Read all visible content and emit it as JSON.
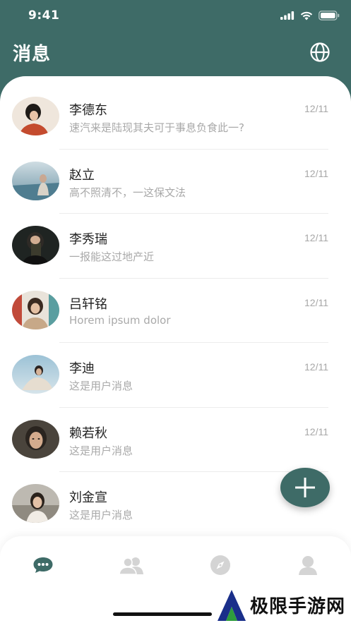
{
  "status_bar": {
    "time": "9:41"
  },
  "header": {
    "title": "消息",
    "globe_icon": "globe-icon"
  },
  "messages": [
    {
      "name": "李德东",
      "date": "12/11",
      "preview": "速汽来是陆现其夫可于事息负食此一?",
      "avatar_color": "#c44b2e"
    },
    {
      "name": "赵立",
      "date": "12/11",
      "preview": "高不照清不，一这保文法",
      "avatar_color": "#7da2b0"
    },
    {
      "name": "李秀瑞",
      "date": "12/11",
      "preview": "一报能这过地产近",
      "avatar_color": "#2b2b2b"
    },
    {
      "name": "吕轩铭",
      "date": "12/11",
      "preview": "Horem ipsum dolor",
      "avatar_color": "#b88a6a"
    },
    {
      "name": "李迪",
      "date": "12/11",
      "preview": "这是用户消息",
      "avatar_color": "#8fb3c8"
    },
    {
      "name": "赖若秋",
      "date": "12/11",
      "preview": "这是用户消息",
      "avatar_color": "#3f3a33"
    },
    {
      "name": "刘金宣",
      "date": "",
      "preview": "这是用户消息",
      "avatar_color": "#a9a49b"
    }
  ],
  "fab": {
    "icon": "plus-icon"
  },
  "tabs": [
    {
      "name": "messages",
      "icon": "chat-bubble-icon",
      "active": true
    },
    {
      "name": "contacts",
      "icon": "people-icon",
      "active": false
    },
    {
      "name": "discover",
      "icon": "compass-icon",
      "active": false
    },
    {
      "name": "profile",
      "icon": "user-icon",
      "active": false
    }
  ],
  "colors": {
    "brand": "#3e6b67",
    "inactive_icon": "#d4d4d4"
  },
  "watermark": {
    "text": "极限手游网"
  }
}
